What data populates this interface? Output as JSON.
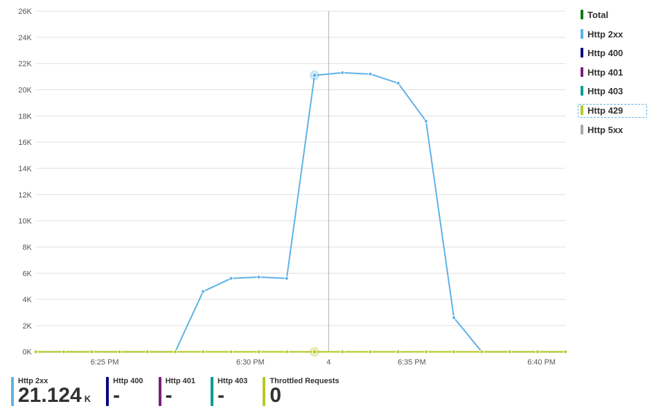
{
  "chart_data": {
    "type": "line",
    "title": "",
    "xlabel": "",
    "ylabel": "",
    "ylim": [
      0,
      26000
    ],
    "y_ticks": [
      0,
      2000,
      4000,
      6000,
      8000,
      10000,
      12000,
      14000,
      16000,
      18000,
      20000,
      22000,
      24000,
      26000
    ],
    "y_tick_labels": [
      "0K",
      "2K",
      "4K",
      "6K",
      "8K",
      "10K",
      "12K",
      "14K",
      "16K",
      "18K",
      "20K",
      "22K",
      "24K",
      "26K"
    ],
    "x_tick_labels": [
      "6:25 PM",
      "6:30 PM",
      "4",
      "6:35 PM",
      "6:40 PM"
    ],
    "x_tick_positions": [
      0.13,
      0.405,
      0.553,
      0.71,
      0.955
    ],
    "crosshair_x": 0.553,
    "hover_index": 10,
    "series": [
      {
        "name": "Total",
        "color": "#107c10",
        "values": null
      },
      {
        "name": "Http 2xx",
        "color": "#5db2e5",
        "values": [
          0,
          0,
          0,
          0,
          0,
          0,
          4600,
          5600,
          5700,
          5600,
          21100,
          21300,
          21200,
          20500,
          17600,
          2600,
          0,
          0,
          0,
          0
        ]
      },
      {
        "name": "Http 400",
        "color": "#000080",
        "values": null
      },
      {
        "name": "Http 401",
        "color": "#7a1e7a",
        "values": null
      },
      {
        "name": "Http 403",
        "color": "#009b8e",
        "values": null
      },
      {
        "name": "Http 429",
        "color": "#b8c924",
        "values": [
          0,
          0,
          0,
          0,
          0,
          0,
          0,
          0,
          0,
          0,
          0,
          0,
          0,
          0,
          0,
          0,
          0,
          0,
          0,
          0
        ],
        "selected": true
      },
      {
        "name": "Http 5xx",
        "color": "#a6a6a6",
        "values": null
      }
    ]
  },
  "legend": [
    {
      "label": "Total",
      "color": "#107c10",
      "selected": false
    },
    {
      "label": "Http 2xx",
      "color": "#5db2e5",
      "selected": false
    },
    {
      "label": "Http 400",
      "color": "#000080",
      "selected": false
    },
    {
      "label": "Http 401",
      "color": "#7a1e7a",
      "selected": false
    },
    {
      "label": "Http 403",
      "color": "#009b8e",
      "selected": false
    },
    {
      "label": "Http 429",
      "color": "#b8c924",
      "selected": true
    },
    {
      "label": "Http 5xx",
      "color": "#a6a6a6",
      "selected": false
    }
  ],
  "stats": [
    {
      "label": "Http 2xx",
      "value": "21.124",
      "unit": "K",
      "color": "#5db2e5"
    },
    {
      "label": "Http 400",
      "value": "-",
      "unit": "",
      "color": "#000080"
    },
    {
      "label": "Http 401",
      "value": "-",
      "unit": "",
      "color": "#7a1e7a"
    },
    {
      "label": "Http 403",
      "value": "-",
      "unit": "",
      "color": "#009b8e"
    },
    {
      "label": "Throttled Requests",
      "value": "0",
      "unit": "",
      "color": "#b8c924"
    }
  ]
}
